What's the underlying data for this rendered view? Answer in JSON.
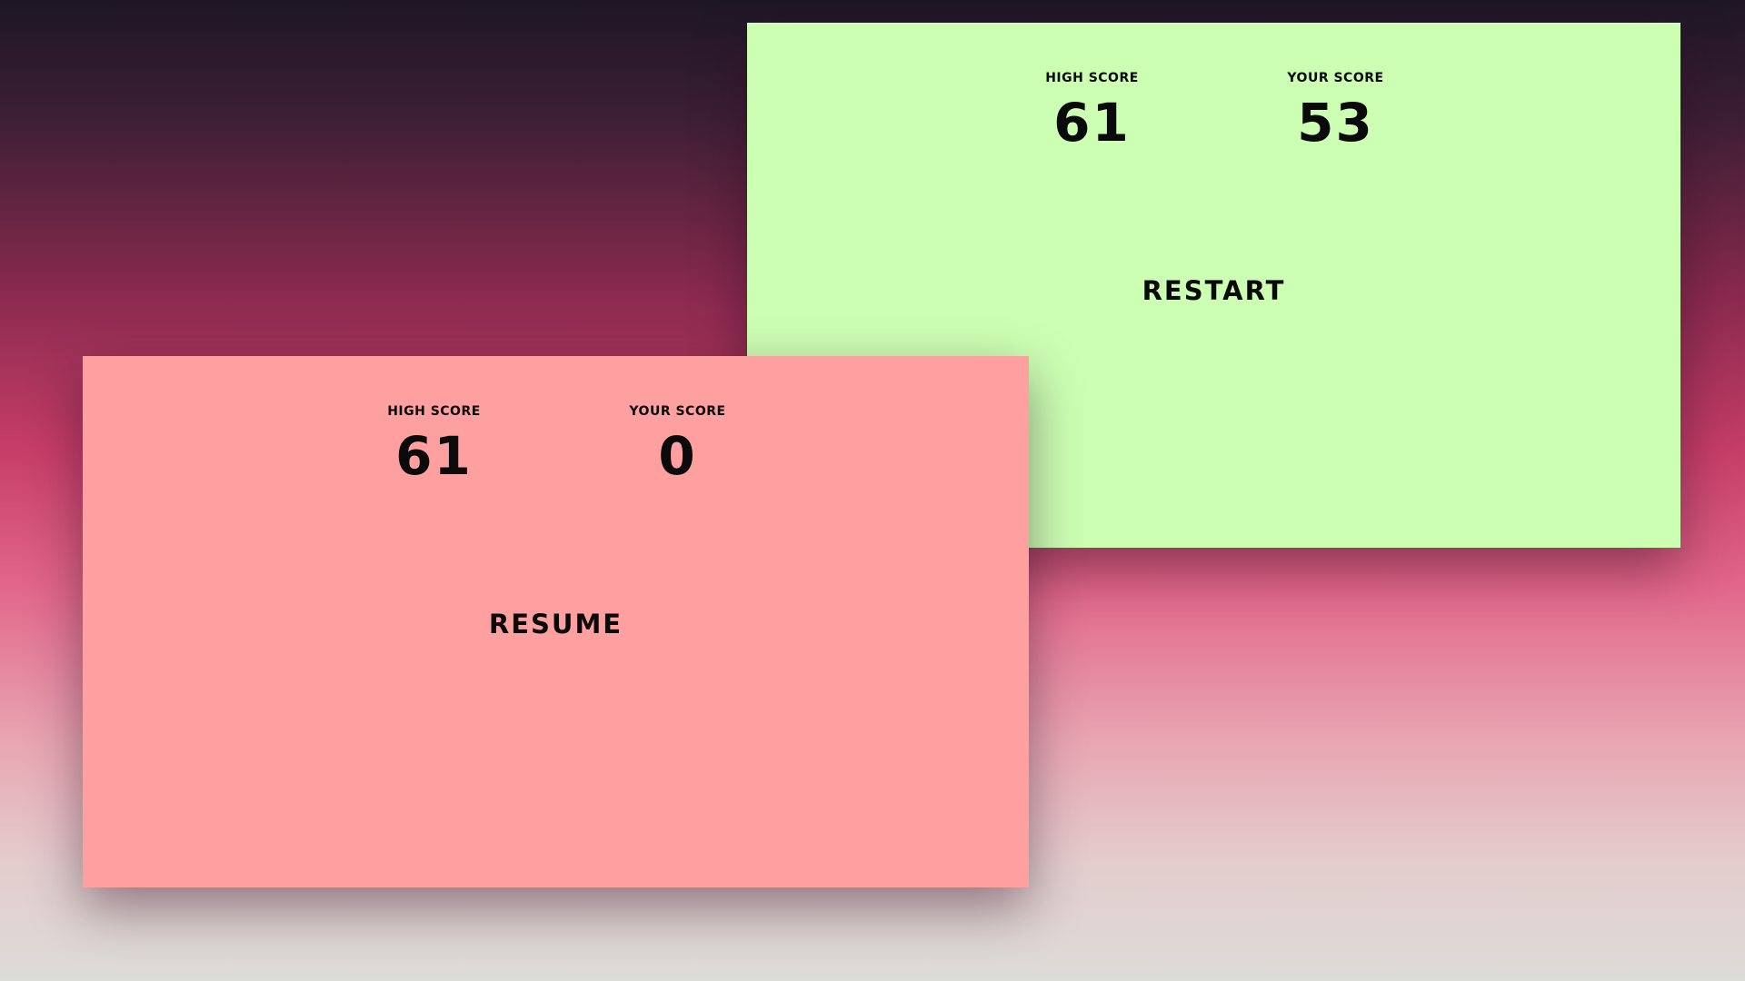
{
  "colors": {
    "restart_card": "#ccffb3",
    "resume_card": "#ffa0a0",
    "text": "#0a0a0a"
  },
  "restart_panel": {
    "high_score_label": "HIGH SCORE",
    "high_score_value": "61",
    "your_score_label": "YOUR SCORE",
    "your_score_value": "53",
    "button_label": "RESTART"
  },
  "resume_panel": {
    "high_score_label": "HIGH SCORE",
    "high_score_value": "61",
    "your_score_label": "YOUR SCORE",
    "your_score_value": "0",
    "button_label": "RESUME"
  }
}
